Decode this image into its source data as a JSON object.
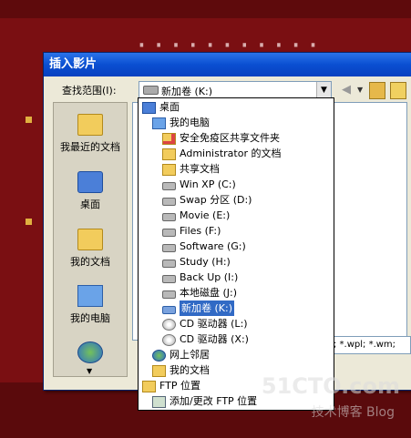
{
  "background": {
    "slide_title": "···········"
  },
  "dialog": {
    "title": "插入影片",
    "look_in_label": "查找范围(I):",
    "look_in_value": "新加卷 (K:)",
    "file_filter": "; *.wpl; *.wm;"
  },
  "places": [
    {
      "label": "我最近的文档",
      "icon": "folder-icon"
    },
    {
      "label": "桌面",
      "icon": "desktop-icon"
    },
    {
      "label": "我的文档",
      "icon": "folder-icon"
    },
    {
      "label": "我的电脑",
      "icon": "computer-icon"
    },
    {
      "label": "",
      "icon": "globe-icon"
    }
  ],
  "dropdown_items": [
    {
      "label": "桌面",
      "icon": "desktop-icon",
      "indent": 0
    },
    {
      "label": "我的电脑",
      "icon": "computer-icon",
      "indent": 1
    },
    {
      "label": "安全免疫区共享文件夹",
      "icon": "shared-folder-icon",
      "indent": 2
    },
    {
      "label": "Administrator 的文档",
      "icon": "folder-icon",
      "indent": 2
    },
    {
      "label": "共享文档",
      "icon": "folder-icon",
      "indent": 2
    },
    {
      "label": "Win XP (C:)",
      "icon": "drive-icon",
      "indent": 2
    },
    {
      "label": "Swap 分区 (D:)",
      "icon": "drive-icon",
      "indent": 2
    },
    {
      "label": "Movie (E:)",
      "icon": "drive-icon",
      "indent": 2
    },
    {
      "label": "Files (F:)",
      "icon": "drive-icon",
      "indent": 2
    },
    {
      "label": "Software (G:)",
      "icon": "drive-icon",
      "indent": 2
    },
    {
      "label": "Study (H:)",
      "icon": "drive-icon",
      "indent": 2
    },
    {
      "label": "Back Up (I:)",
      "icon": "drive-icon",
      "indent": 2
    },
    {
      "label": "本地磁盘 (J:)",
      "icon": "drive-icon",
      "indent": 2
    },
    {
      "label": "新加卷 (K:)",
      "icon": "drive-icon",
      "indent": 2,
      "selected": true
    },
    {
      "label": "CD 驱动器 (L:)",
      "icon": "cd-drive-icon",
      "indent": 2
    },
    {
      "label": "CD 驱动器 (X:)",
      "icon": "cd-drive-icon",
      "indent": 2
    },
    {
      "label": "网上邻居",
      "icon": "network-icon",
      "indent": 1
    },
    {
      "label": "我的文档",
      "icon": "folder-icon",
      "indent": 1
    },
    {
      "label": "FTP 位置",
      "icon": "ftp-folder-icon",
      "indent": 0
    },
    {
      "label": "添加/更改 FTP 位置",
      "icon": "ftp-add-icon",
      "indent": 1
    }
  ],
  "watermark": {
    "line1": "51CTO.com",
    "line2": "技术博客 Blog"
  }
}
